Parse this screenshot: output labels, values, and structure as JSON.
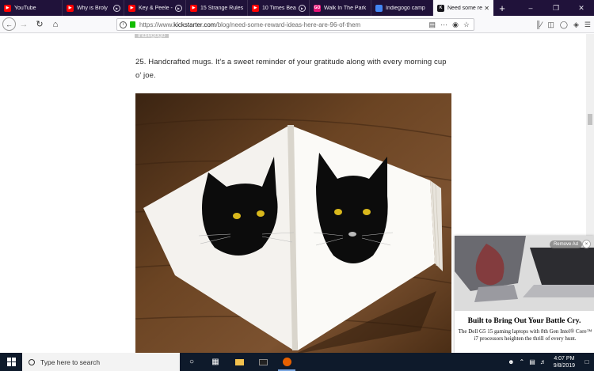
{
  "browser": {
    "tabs": [
      {
        "label": "YouTube",
        "favicon": "youtube-icon",
        "color": "#ff0000",
        "playing": false
      },
      {
        "label": "Why is Broly",
        "favicon": "youtube-icon",
        "color": "#ff0000",
        "playing": true
      },
      {
        "label": "Key & Peele - \"I",
        "favicon": "youtube-icon",
        "color": "#ff0000",
        "playing": true
      },
      {
        "label": "15 Strange Rules",
        "favicon": "youtube-icon",
        "color": "#ff0000",
        "playing": false
      },
      {
        "label": "10 Times Bea",
        "favicon": "youtube-icon",
        "color": "#ff0000",
        "playing": true
      },
      {
        "label": "Walk In The Park",
        "favicon": "gogo-icon",
        "color": "#e51075",
        "playing": false
      },
      {
        "label": "Indiegogo camp",
        "favicon": "docs-icon",
        "color": "#4285f4",
        "playing": false
      },
      {
        "label": "Need some re",
        "favicon": "kickstarter-icon",
        "color": "#15141a",
        "playing": false,
        "active": true
      }
    ],
    "url": {
      "protocol": "https://www.",
      "host": "kickstarter.com",
      "path": "/blog/need-some-reward-ideas-here-are-96-of-them"
    }
  },
  "article": {
    "prev_tag": "indiegogo",
    "paragraph": "25. Handcrafted mugs. It's a sweet reminder of your gratitude along with every morning cup o' joe."
  },
  "ad": {
    "remove_label": "Remove Ad",
    "close_glyph": "×",
    "headline": "Built to Bring Out Your Battle Cry.",
    "body": "The Dell G5 15 gaming laptops with 8th Gen Intel® Core™ i7 processors heighten the thrill of every hunt.",
    "laptop_brand": "G5"
  },
  "taskbar": {
    "search_placeholder": "Type here to search",
    "time": "4:07 PM",
    "date": "9/8/2019"
  }
}
